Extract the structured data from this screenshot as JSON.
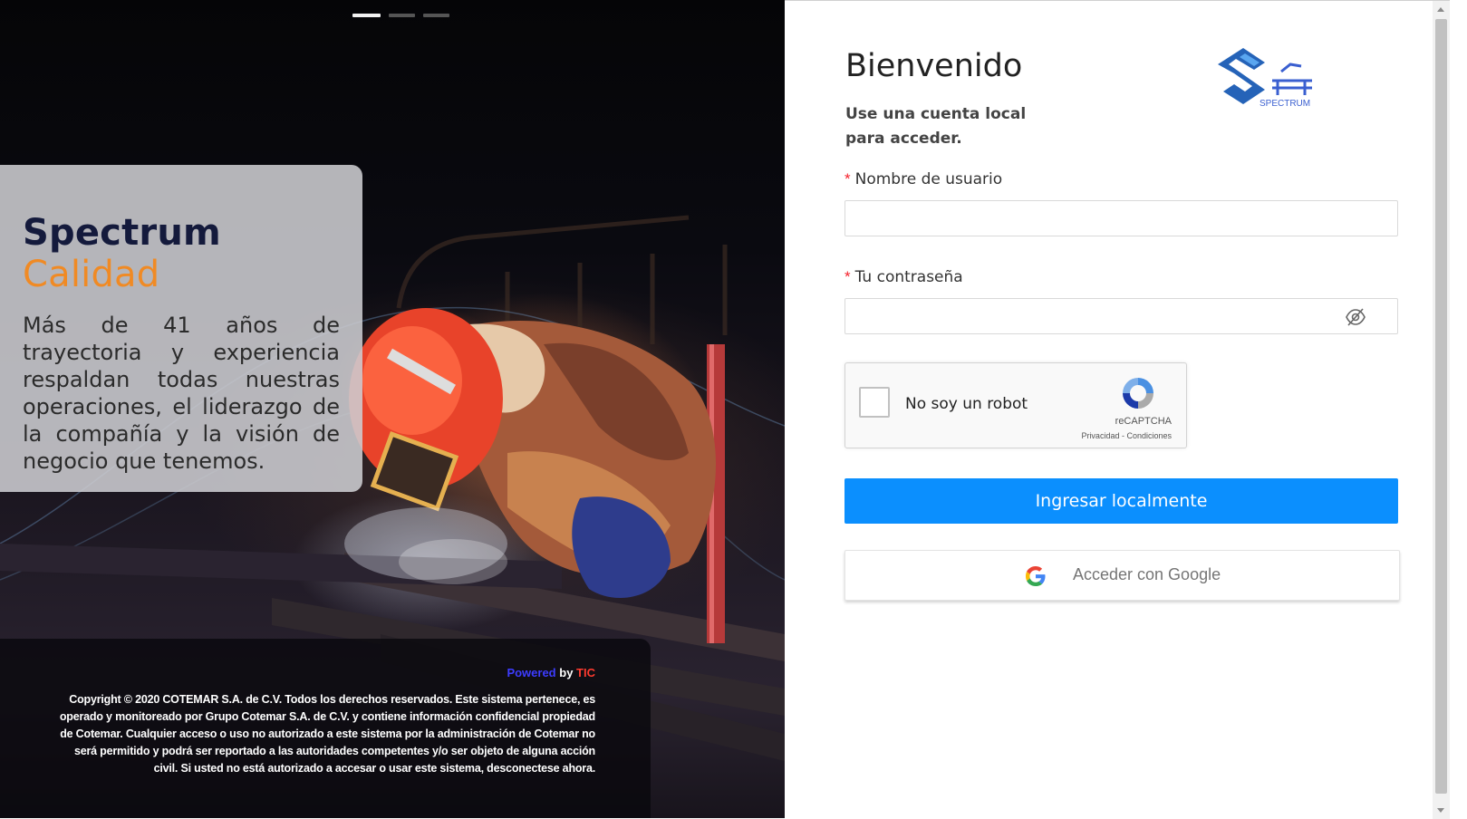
{
  "hero": {
    "slides_count": 3,
    "active_slide": 1,
    "promo": {
      "title_main": "Spectrum",
      "title_accent": "Calidad",
      "body": "Más de 41 años de trayectoria y experiencia respaldan todas nuestras operaciones, el liderazgo de la compañía y la visión de negocio que tenemos."
    },
    "footer": {
      "powered": "Powered",
      "by": "by",
      "tic": "TIC",
      "copyright": "Copyright © 2020 COTEMAR S.A. de C.V. Todos los derechos reservados. Este sistema pertenece, es operado y monitoreado por Grupo Cotemar S.A. de C.V. y contiene información confidencial propiedad de Cotemar. Cualquier acceso o uso no autorizado a este sistema por la administración de Cotemar no será permitido y podrá ser reportado a las autoridades competentes y/o ser objeto de alguna acción civil. Si usted no está autorizado a accesar o usar este sistema, desconectese ahora."
    }
  },
  "login": {
    "title": "Bienvenido",
    "subtitle": "Use una cuenta local para acceder.",
    "logo_text": "SPECTRUM",
    "username": {
      "required_mark": "*",
      "label": "Nombre de usuario",
      "value": ""
    },
    "password": {
      "required_mark": "*",
      "label": "Tu contraseña",
      "value": ""
    },
    "captcha": {
      "label": "No soy un robot",
      "brand": "reCAPTCHA",
      "links": "Privacidad - Condiciones"
    },
    "submit_label": "Ingresar localmente",
    "google_label": "Acceder con Google"
  },
  "colors": {
    "accent_orange": "#f08a24",
    "primary_blue": "#0b8ffe",
    "title_navy": "#141a3c",
    "required_red": "#f5222d",
    "powered_blue": "#3d3cff",
    "tic_red": "#ff3b2f"
  },
  "icons": {
    "password_toggle": "eye-slash-icon",
    "captcha": "recaptcha-icon",
    "google": "google-icon"
  }
}
